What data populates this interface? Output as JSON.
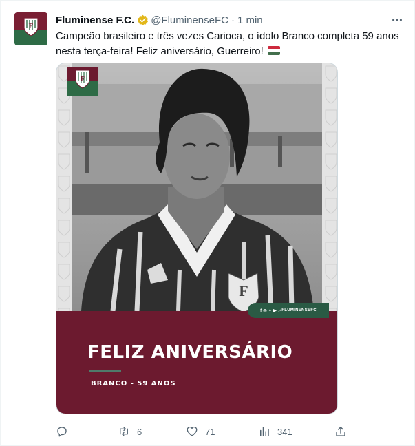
{
  "account": {
    "name": "Fluminense F.C.",
    "handle": "@FluminenseFC",
    "separator": "·",
    "time": "1 min",
    "verified_icon": "verified-badge-icon",
    "avatar_colors": {
      "top": "#7a1f33",
      "bottom": "#2e6b46"
    }
  },
  "tweet": {
    "text": "Campeão brasileiro e três vezes Carioca, o ídolo Branco completa 59 anos nesta terça-feira! Feliz aniversário, Guerreiro!",
    "flag_icon": "hungary-flag-icon"
  },
  "media": {
    "headline": "FELIZ ANIVERSÁRIO",
    "subline": "BRANCO - 59 ANOS",
    "social_handle": "/FLUMINENSEFC",
    "banner_color": "#6c1a2f",
    "accent_color": "#2a5a44"
  },
  "actions": {
    "reply": {
      "icon": "reply-icon",
      "count": ""
    },
    "retweet": {
      "icon": "retweet-icon",
      "count": "6"
    },
    "like": {
      "icon": "heart-icon",
      "count": "71"
    },
    "views": {
      "icon": "views-chart-icon",
      "count": "341"
    },
    "share": {
      "icon": "share-icon",
      "count": ""
    }
  },
  "more_icon": "more-options-icon"
}
